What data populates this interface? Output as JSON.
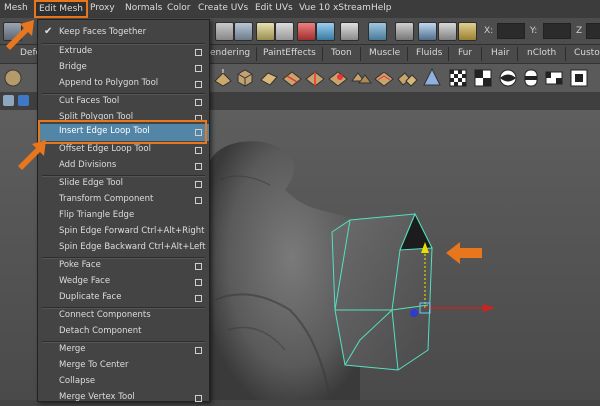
{
  "menubar": {
    "items": [
      "Mesh",
      "Edit Mesh",
      "Proxy",
      "Normals",
      "Color",
      "Create UVs",
      "Edit UVs",
      "Vue 10 xStream",
      "Help"
    ]
  },
  "statusline": {
    "x_label": "X:",
    "y_label": "Y:",
    "z_label": "Z"
  },
  "shelf": {
    "tabs": [
      "Defo",
      "endering",
      "PaintEffects",
      "Toon",
      "Muscle",
      "Fluids",
      "Fur",
      "Hair",
      "nCloth",
      "Custo"
    ]
  },
  "edit_mesh_menu": {
    "items": [
      {
        "label": "Keep Faces Together",
        "checked": true,
        "option_box": false
      },
      {
        "label": "Extrude",
        "option_box": true
      },
      {
        "label": "Bridge",
        "option_box": true
      },
      {
        "label": "Append to Polygon Tool",
        "option_box": true
      },
      {
        "label": "Cut Faces Tool",
        "option_box": true
      },
      {
        "label": "Split Polygon Tool",
        "option_box": true
      },
      {
        "label": "Insert Edge Loop Tool",
        "option_box": true,
        "highlighted": true
      },
      {
        "label": "Offset Edge Loop Tool",
        "option_box": true
      },
      {
        "label": "Add Divisions",
        "option_box": true
      },
      {
        "label": "Slide Edge Tool",
        "option_box": true
      },
      {
        "label": "Transform Component",
        "option_box": true
      },
      {
        "label": "Flip Triangle Edge",
        "option_box": false
      },
      {
        "label": "Spin Edge Forward  Ctrl+Alt+Right",
        "option_box": false
      },
      {
        "label": "Spin Edge Backward  Ctrl+Alt+Left",
        "option_box": false
      },
      {
        "label": "Poke Face",
        "option_box": true
      },
      {
        "label": "Wedge Face",
        "option_box": true
      },
      {
        "label": "Duplicate Face",
        "option_box": true
      },
      {
        "label": "Connect Components",
        "option_box": false
      },
      {
        "label": "Detach Component",
        "option_box": false
      },
      {
        "label": "Merge",
        "option_box": true
      },
      {
        "label": "Merge To Center",
        "option_box": false
      },
      {
        "label": "Collapse",
        "option_box": false
      },
      {
        "label": "Merge Vertex Tool",
        "option_box": true
      }
    ]
  },
  "colors": {
    "highlight": "#5285a6",
    "annotation": "#e8761c",
    "wireframe": "#55e0c0"
  }
}
